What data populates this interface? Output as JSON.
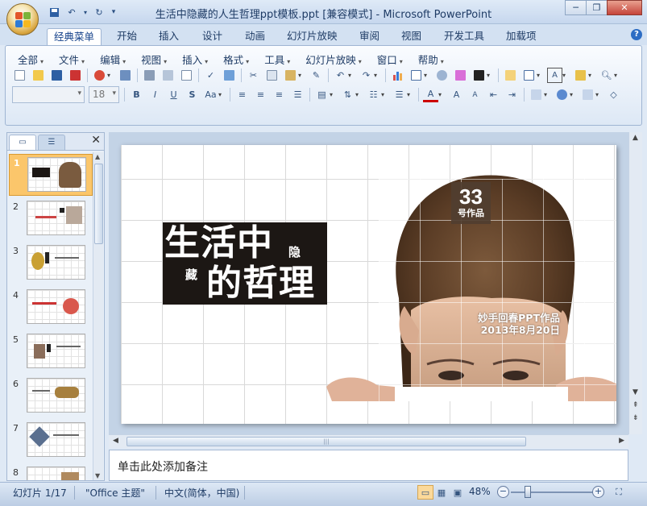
{
  "window": {
    "title": "生活中隐藏的人生哲理ppt模板.ppt [兼容模式] - Microsoft PowerPoint",
    "controls": [
      "minimize-icon",
      "restore-icon",
      "close-icon"
    ]
  },
  "qat": [
    "save-icon",
    "undo-icon",
    "redo-icon",
    "customize-icon"
  ],
  "tabs": [
    "经典菜单",
    "开始",
    "插入",
    "设计",
    "动画",
    "幻灯片放映",
    "审阅",
    "视图",
    "开发工具",
    "加载项"
  ],
  "menus": [
    "全部",
    "文件",
    "编辑",
    "视图",
    "插入",
    "格式",
    "工具",
    "幻灯片放映",
    "窗口",
    "帮助"
  ],
  "font": {
    "size": "18"
  },
  "slides": [
    "1",
    "2",
    "3",
    "4",
    "5",
    "6",
    "7",
    "8"
  ],
  "slide": {
    "title_big1": "生活中",
    "title_small1": "隐",
    "title_small2": "藏",
    "title_big2": "的哲理",
    "badge_number": "33",
    "badge_label": "号作品",
    "credit_line1": "妙手回春PPT作品",
    "credit_line2": "2013年8月20日"
  },
  "notes_placeholder": "单击此处添加备注",
  "status": {
    "slide_info": "幻灯片 1/17",
    "theme": "\"Office 主题\"",
    "language": "中文(简体，中国)",
    "zoom": "48%"
  },
  "colors": {
    "title_block": "#1c1714",
    "badge": "#503e30",
    "selected_thumb": "#fbc66b",
    "ribbon_bg": "#dde8f5"
  }
}
